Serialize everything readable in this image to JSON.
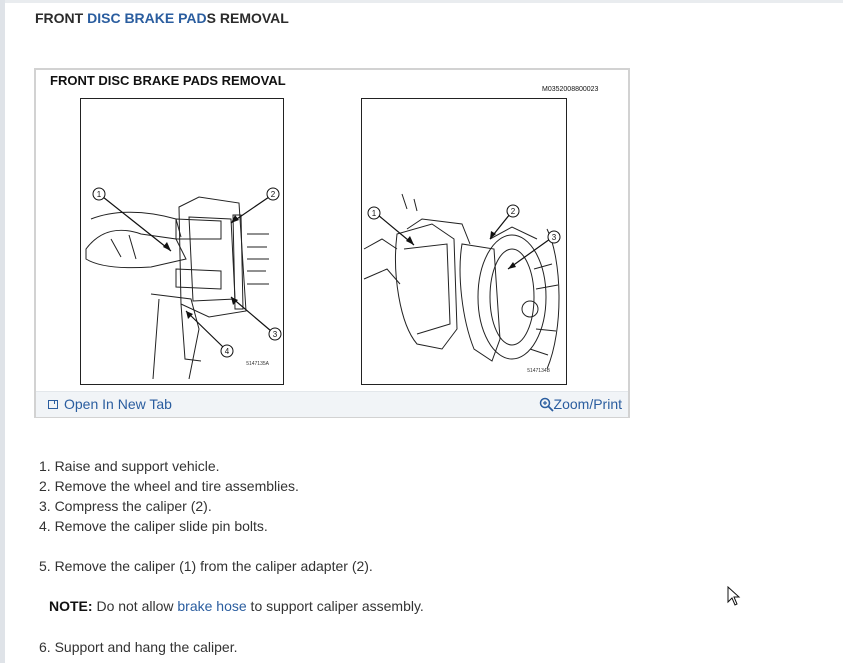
{
  "page": {
    "title_pre": "FRONT ",
    "title_link": "DISC BRAKE PAD",
    "title_post": "S REMOVAL"
  },
  "figure": {
    "title": "FRONT DISC BRAKE PADS REMOVAL",
    "code": "M0352008800023",
    "panel_a_code": "5147135A",
    "panel_b_code": "5147134B",
    "callouts_a": [
      "1",
      "2",
      "3",
      "4"
    ],
    "callouts_b": [
      "1",
      "2",
      "3"
    ],
    "open_tab_label": "Open In New Tab",
    "zoom_print_label": "Zoom/Print"
  },
  "steps": [
    "1. Raise and support vehicle.",
    "2. Remove the wheel and tire assemblies.",
    "3. Compress the caliper (2).",
    "4. Remove the caliper slide pin bolts.",
    "5. Remove the caliper (1) from the caliper adapter (2).",
    "6. Support and hang the caliper."
  ],
  "note": {
    "label": "NOTE:",
    "text_pre": " Do not allow ",
    "link": "brake hose",
    "text_post": " to support caliper assembly."
  }
}
